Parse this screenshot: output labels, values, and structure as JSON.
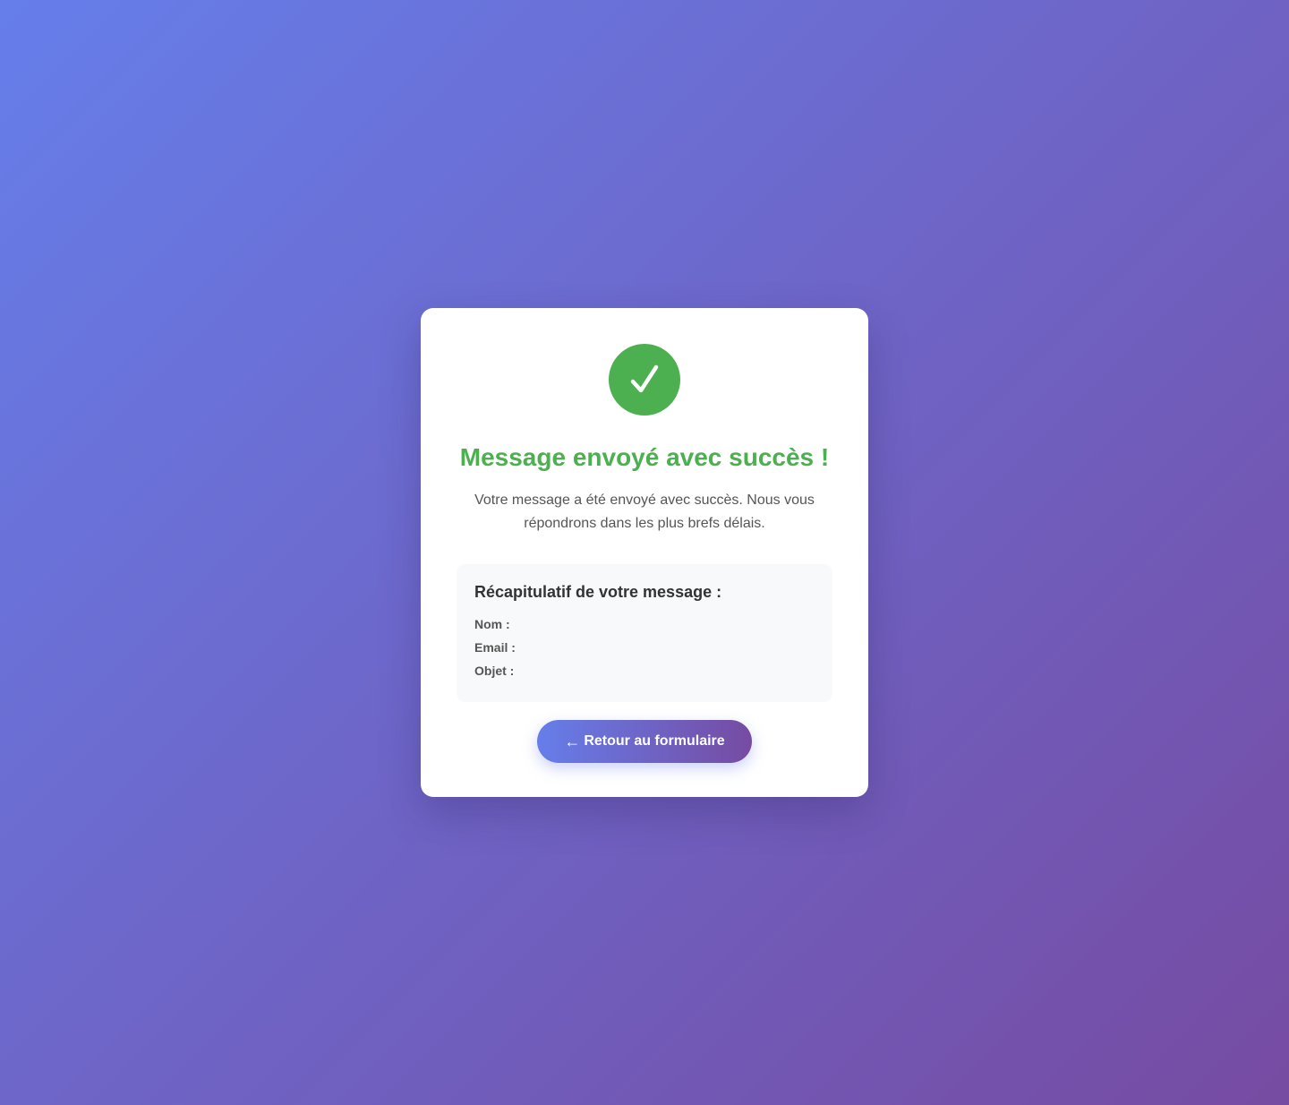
{
  "success_icon": {
    "name": "checkmark-icon",
    "color": "#4caf50"
  },
  "title": "Message envoyé avec succès !",
  "description": "Votre message a été envoyé avec succès. Nous vous répondrons dans les plus brefs délais.",
  "summary": {
    "title": "Récapitulatif de votre message :",
    "rows": [
      {
        "label": "Nom :",
        "value": ""
      },
      {
        "label": "Email :",
        "value": ""
      },
      {
        "label": "Objet :",
        "value": ""
      }
    ]
  },
  "back_button": {
    "arrow": "←",
    "label": "Retour au formulaire"
  },
  "colors": {
    "gradient_start": "#667eea",
    "gradient_end": "#764ba2",
    "success": "#4caf50"
  }
}
